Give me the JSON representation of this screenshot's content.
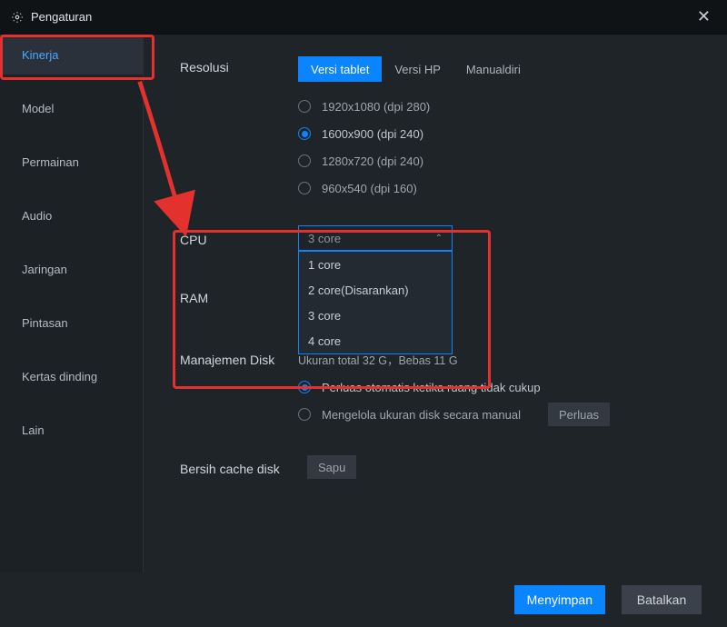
{
  "window": {
    "title": "Pengaturan"
  },
  "sidebar": {
    "items": [
      {
        "label": "Kinerja"
      },
      {
        "label": "Model"
      },
      {
        "label": "Permainan"
      },
      {
        "label": "Audio"
      },
      {
        "label": "Jaringan"
      },
      {
        "label": "Pintasan"
      },
      {
        "label": "Kertas dinding"
      },
      {
        "label": "Lain"
      }
    ]
  },
  "resolution": {
    "label": "Resolusi",
    "segments": [
      {
        "label": "Versi tablet"
      },
      {
        "label": "Versi HP"
      },
      {
        "label": "Manualdiri"
      }
    ],
    "options": [
      {
        "label": "1920x1080  (dpi 280)"
      },
      {
        "label": "1600x900  (dpi 240)"
      },
      {
        "label": "1280x720  (dpi 240)"
      },
      {
        "label": "960x540  (dpi 160)"
      }
    ]
  },
  "cpu": {
    "label": "CPU",
    "selected": "3 core",
    "options": [
      {
        "label": "1 core"
      },
      {
        "label": "2 core(Disarankan)"
      },
      {
        "label": "3 core"
      },
      {
        "label": "4 core"
      }
    ]
  },
  "ram": {
    "label": "RAM"
  },
  "disk": {
    "label": "Manajemen Disk",
    "info": "Ukuran total 32 G，Bebas 11 G",
    "auto": "Perluas otomatis ketika ruang tidak cukup",
    "manual": "Mengelola ukuran disk secara manual",
    "extend_btn": "Perluas"
  },
  "cache": {
    "label": "Bersih cache disk",
    "btn": "Sapu"
  },
  "footer": {
    "save": "Menyimpan",
    "cancel": "Batalkan"
  }
}
